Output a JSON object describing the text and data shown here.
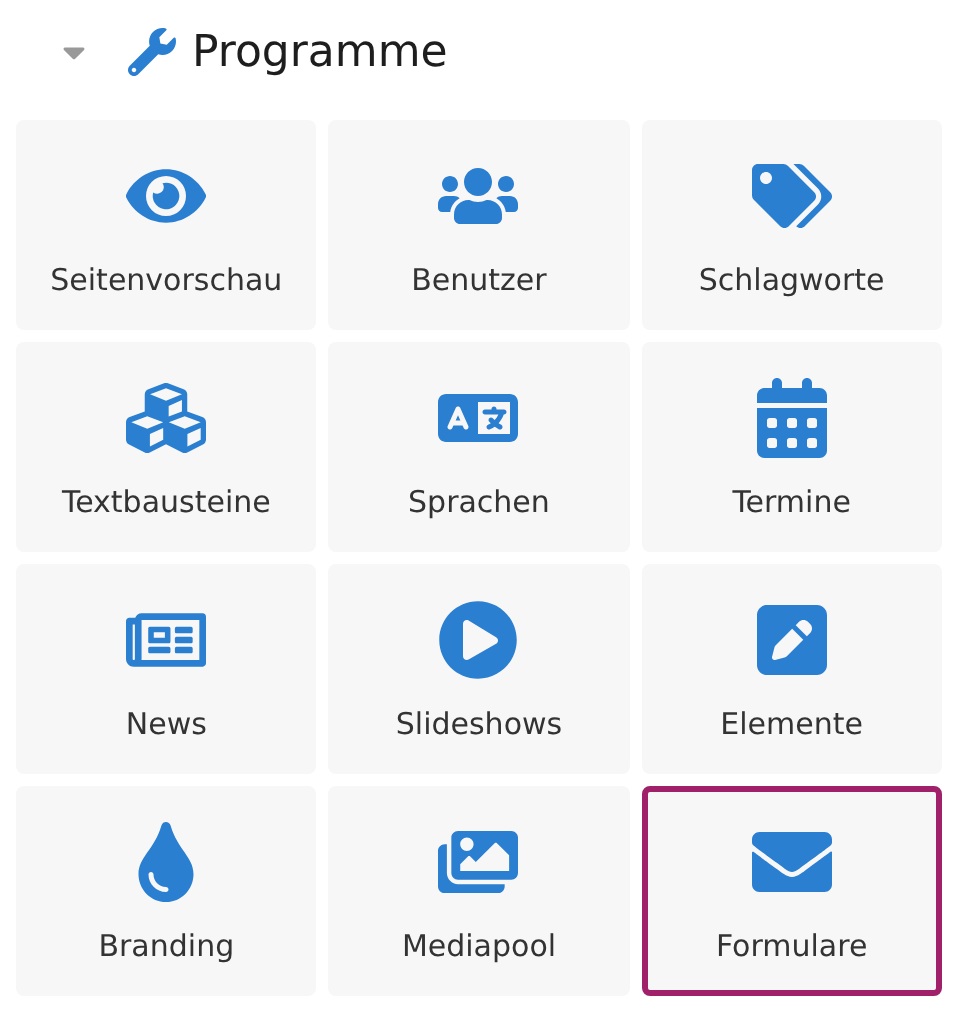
{
  "section": {
    "title": "Programme",
    "expanded": true
  },
  "tiles": [
    {
      "label": "Seitenvorschau",
      "selected": false
    },
    {
      "label": "Benutzer",
      "selected": false
    },
    {
      "label": "Schlagworte",
      "selected": false
    },
    {
      "label": "Textbausteine",
      "selected": false
    },
    {
      "label": "Sprachen",
      "selected": false
    },
    {
      "label": "Termine",
      "selected": false
    },
    {
      "label": "News",
      "selected": false
    },
    {
      "label": "Slideshows",
      "selected": false
    },
    {
      "label": "Elemente",
      "selected": false
    },
    {
      "label": "Branding",
      "selected": false
    },
    {
      "label": "Mediapool",
      "selected": false
    },
    {
      "label": "Formulare",
      "selected": true
    }
  ]
}
